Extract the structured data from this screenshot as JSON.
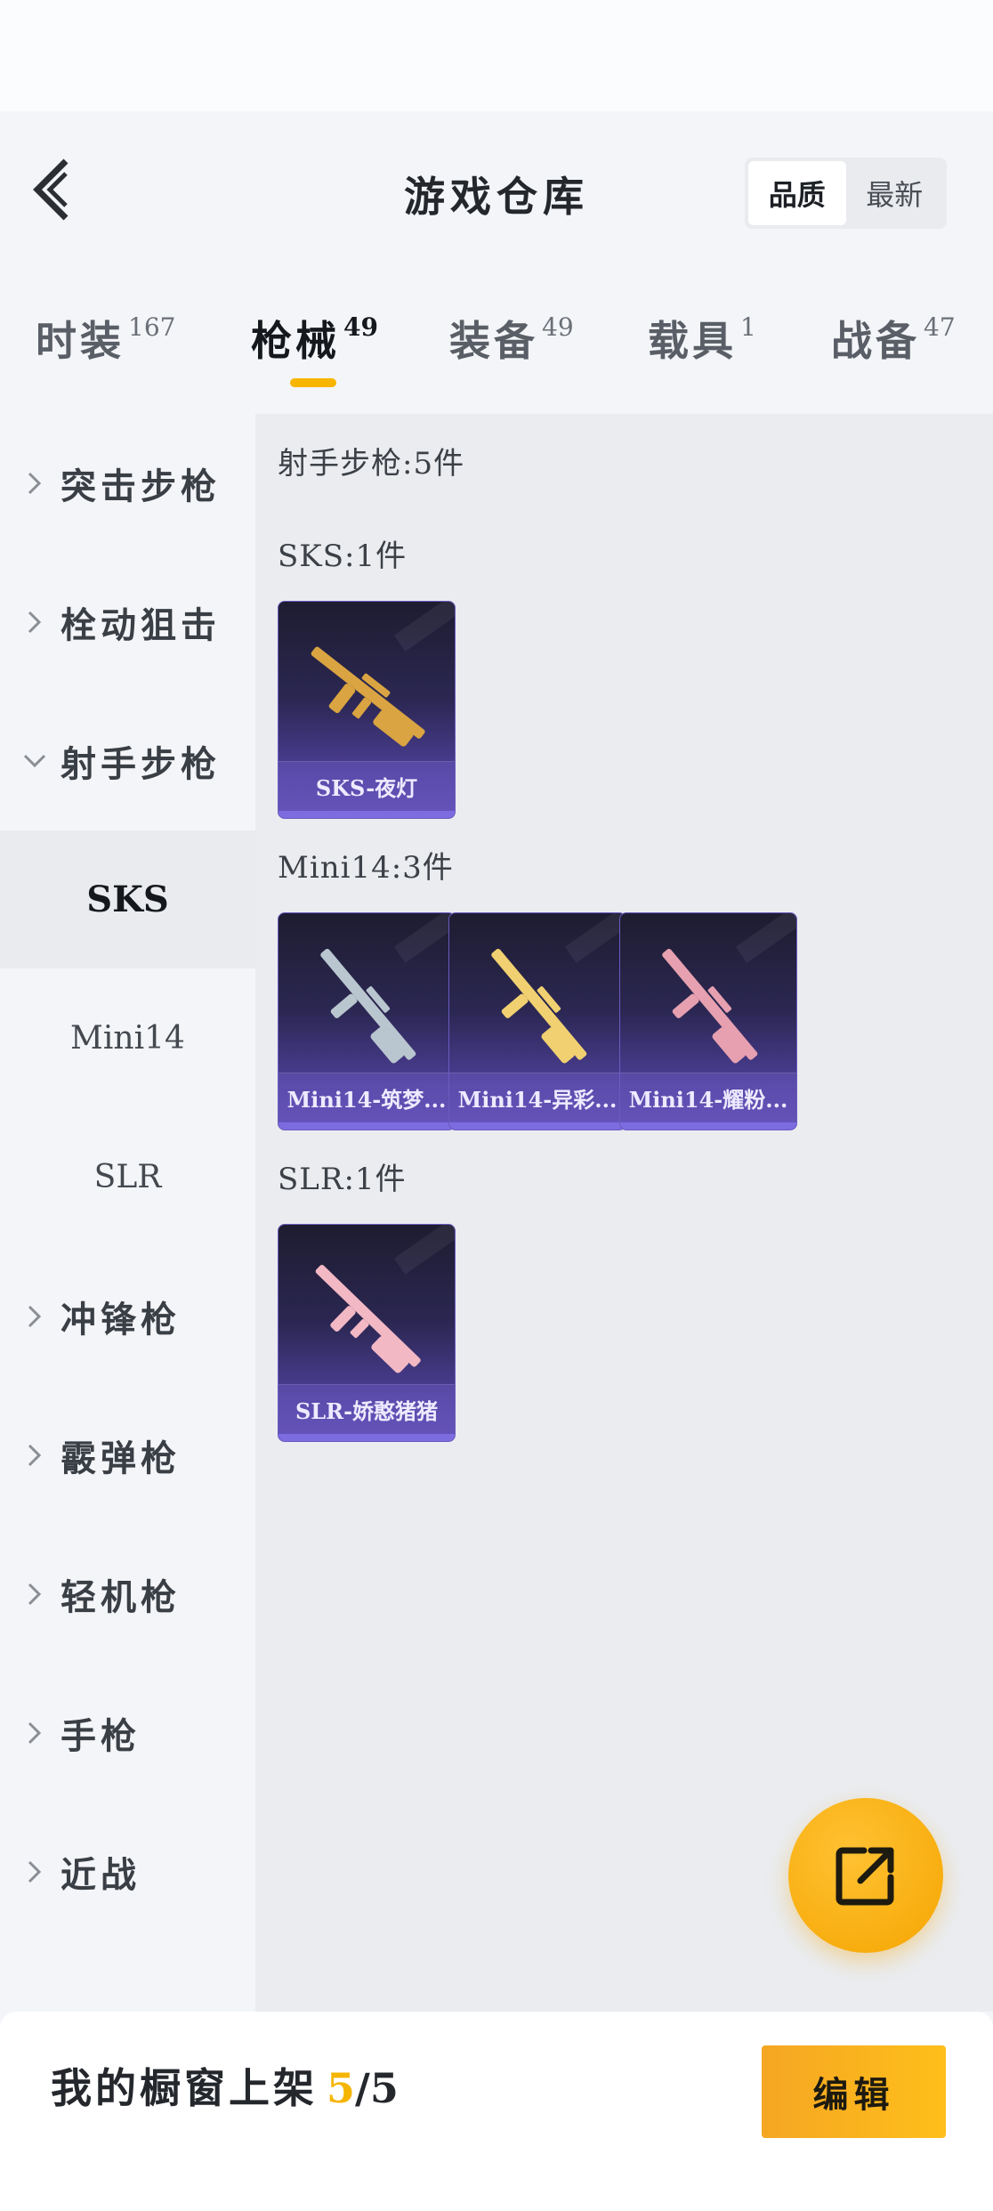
{
  "header": {
    "title": "游戏仓库",
    "sort_options": [
      {
        "label": "品质",
        "active": true
      },
      {
        "label": "最新",
        "active": false
      }
    ]
  },
  "tabs": [
    {
      "label": "时装",
      "count": "167",
      "active": false
    },
    {
      "label": "枪械",
      "count": "49",
      "active": true
    },
    {
      "label": "装备",
      "count": "49",
      "active": false
    },
    {
      "label": "载具",
      "count": "1",
      "active": false
    },
    {
      "label": "战备",
      "count": "47",
      "active": false
    }
  ],
  "sidebar": {
    "categories": [
      {
        "label": "突击步枪",
        "expanded": false
      },
      {
        "label": "栓动狙击",
        "expanded": false
      },
      {
        "label": "射手步枪",
        "expanded": true
      },
      {
        "label": "冲锋枪",
        "expanded": false
      },
      {
        "label": "霰弹枪",
        "expanded": false
      },
      {
        "label": "轻机枪",
        "expanded": false
      },
      {
        "label": "手枪",
        "expanded": false
      },
      {
        "label": "近战",
        "expanded": false
      }
    ],
    "subitems": [
      {
        "label": "SKS",
        "active": true
      },
      {
        "label": "Mini14",
        "active": false
      },
      {
        "label": "SLR",
        "active": false
      }
    ]
  },
  "content": {
    "section_title": "射手步枪:5件",
    "groups": [
      {
        "title": "SKS:1件",
        "items": [
          {
            "name": "SKS-夜灯",
            "gun_color": "#d9a441"
          }
        ]
      },
      {
        "title": "Mini14:3件",
        "items": [
          {
            "name": "Mini14-筑梦...",
            "gun_color": "#b9c6cf"
          },
          {
            "name": "Mini14-异彩...",
            "gun_color": "#f0d070"
          },
          {
            "name": "Mini14-耀粉...",
            "gun_color": "#e6a0b0"
          }
        ]
      },
      {
        "title": "SLR:1件",
        "items": [
          {
            "name": "SLR-娇憨猪猪",
            "gun_color": "#f2b8c4"
          }
        ]
      }
    ]
  },
  "fab": {
    "icon": "share-external-icon"
  },
  "bottom": {
    "label": "我的橱窗上架",
    "current": "5",
    "slash": "/",
    "total": "5",
    "edit_label": "编辑"
  },
  "colors": {
    "accent": "#f7b500",
    "card_gradient_top": "#1e1c30",
    "card_gradient_bottom": "#5d4cb0"
  }
}
